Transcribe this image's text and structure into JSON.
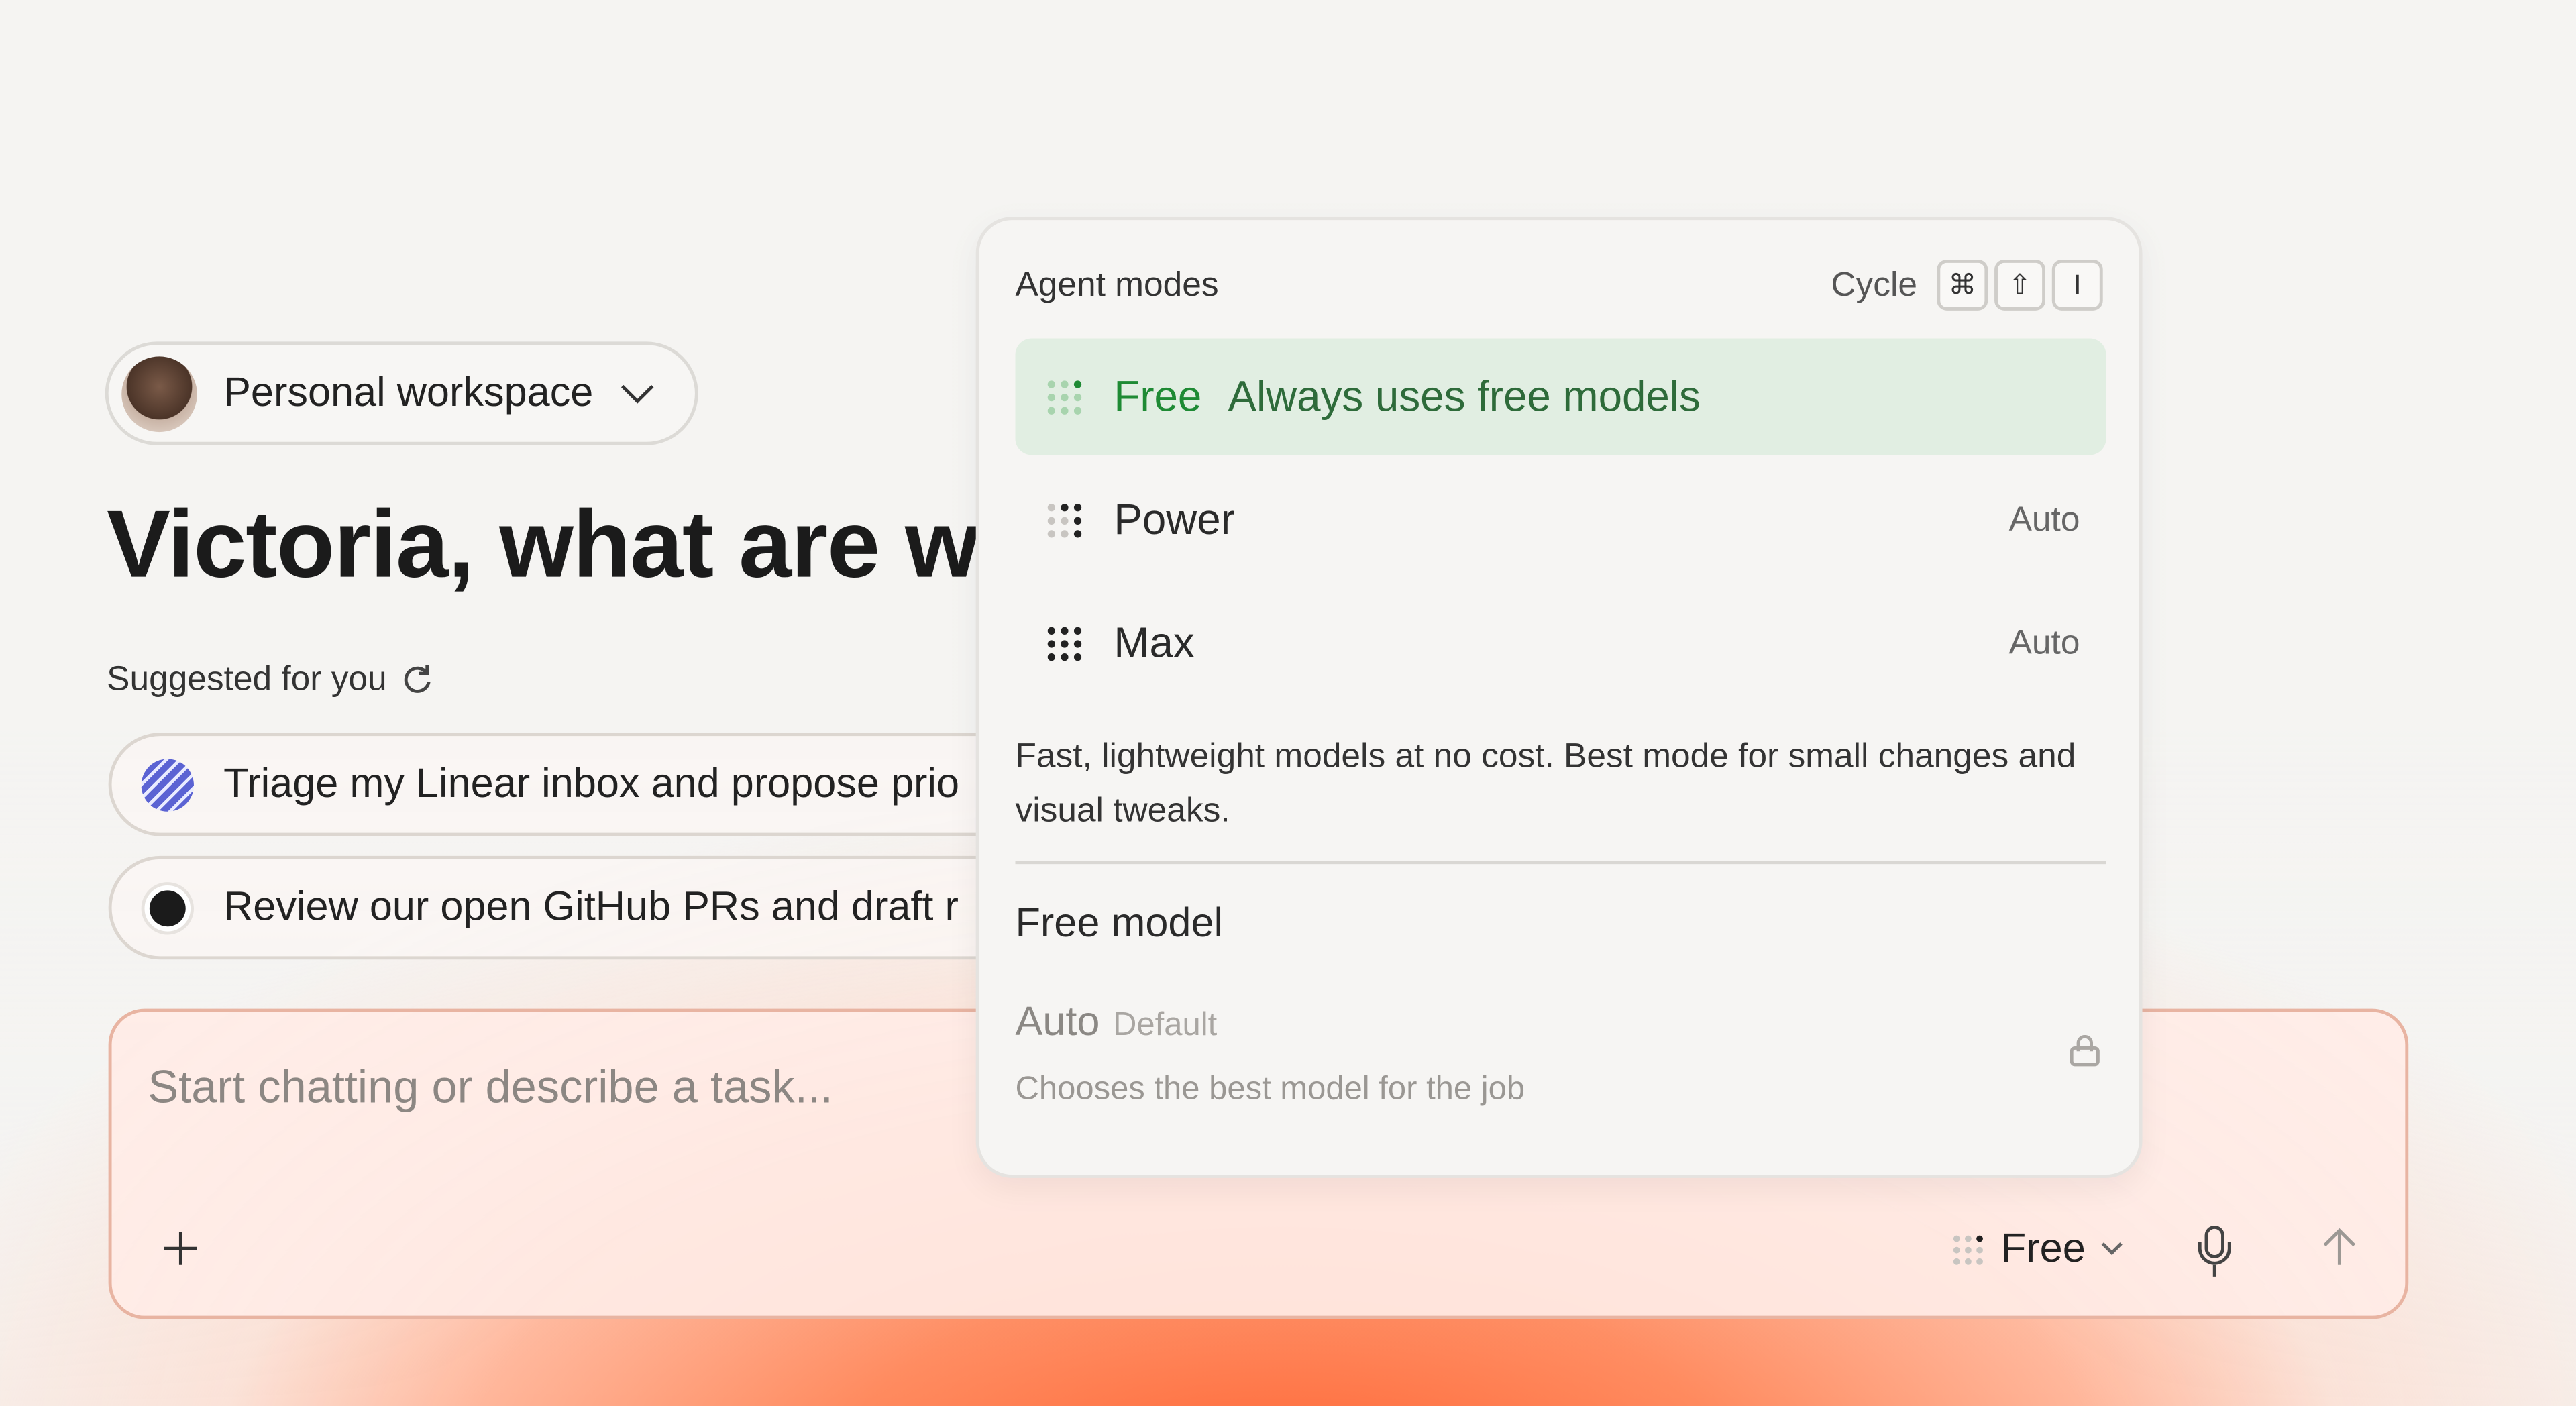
{
  "workspace": {
    "label": "Personal workspace"
  },
  "greeting": {
    "heading": "Victoria, what are we"
  },
  "suggestions": {
    "title": "Suggested for you",
    "items": [
      {
        "text": "Triage my Linear inbox and propose prio",
        "icon": "linear-icon"
      },
      {
        "text": "Review our open GitHub PRs and draft r",
        "icon": "github-icon"
      }
    ]
  },
  "composer": {
    "placeholder": "Start chatting or describe a task...",
    "mode_label": "Free"
  },
  "agent_modes": {
    "title": "Agent modes",
    "cycle_label": "Cycle",
    "shortcut_keys": [
      "⌘",
      "⇧",
      "I"
    ],
    "modes": [
      {
        "name": "Free",
        "description": "Always uses free models",
        "selected": true
      },
      {
        "name": "Power",
        "badge": "Auto"
      },
      {
        "name": "Max",
        "badge": "Auto"
      }
    ],
    "mode_description": "Fast, lightweight models at no cost. Best mode for small changes and visual tweaks.",
    "model_section": {
      "title": "Free model",
      "option_name": "Auto",
      "option_tag": "Default",
      "option_description": "Chooses the best model for the job"
    }
  },
  "colors": {
    "accent_green": "#1e8a34",
    "selected_bg": "#e1eee2",
    "warm_gradient": "#ff6a3a"
  }
}
